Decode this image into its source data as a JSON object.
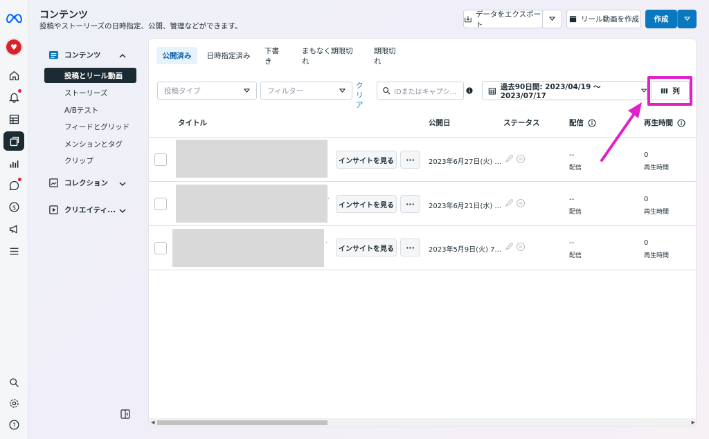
{
  "header": {
    "title": "コンテンツ",
    "subtitle": "投稿やストーリーズの日時指定、公開、管理などができます。",
    "export_label": "データをエクスポート",
    "reel_label": "リール動画を作成",
    "create_label": "作成"
  },
  "rail": {
    "items": [
      "meta-logo",
      "profile-avatar",
      "home",
      "notifications",
      "table-grid",
      "content",
      "insights",
      "messages",
      "monetization",
      "ads",
      "menu",
      "search",
      "settings",
      "help"
    ]
  },
  "sidebar": {
    "contents_label": "コンテンツ",
    "items": [
      {
        "label": "投稿とリール動画"
      },
      {
        "label": "ストーリーズ"
      },
      {
        "label": "A/Bテスト"
      },
      {
        "label": "フィードとグリッド"
      },
      {
        "label": "メンションとタグ"
      },
      {
        "label": "クリップ"
      }
    ],
    "collection_label": "コレクション",
    "creative_label": "クリエイティ..."
  },
  "tabs": [
    {
      "label": "公開済み",
      "active": true
    },
    {
      "label": "日時指定済み"
    },
    {
      "label": "下書き"
    },
    {
      "label": "まもなく期限切れ"
    },
    {
      "label": "期限切れ"
    }
  ],
  "filters": {
    "post_type_placeholder": "投稿タイプ",
    "filter_placeholder": "フィルター",
    "clear_label": "クリア",
    "search_placeholder": "IDまたはキャプシ...",
    "date_range": "過去90日間: 2023/04/19 〜 2023/07/17",
    "columns_label": "列"
  },
  "table": {
    "headers": {
      "title": "タイトル",
      "published": "公開日",
      "status": "ステータス",
      "delivery": "配信",
      "playtime": "再生時間"
    },
    "insight_label": "インサイトを見る",
    "more_label": "···",
    "rows": [
      {
        "date": "2023年6月27日(火) ...",
        "delivery_value": "--",
        "delivery_label": "配信",
        "playtime_value": "0",
        "playtime_label": "再生時間"
      },
      {
        "date": "2023年6月21日(水) ...",
        "delivery_value": "--",
        "delivery_label": "配信",
        "playtime_value": "0",
        "playtime_label": "再生時間"
      },
      {
        "date": "2023年5月9日(火) 7...",
        "delivery_value": "--",
        "delivery_label": "配信",
        "playtime_value": "0",
        "playtime_label": "再生時間"
      }
    ]
  },
  "colors": {
    "accent": "#0a78be",
    "annotation": "#e020c8",
    "nav_active": "#1c2b33"
  }
}
